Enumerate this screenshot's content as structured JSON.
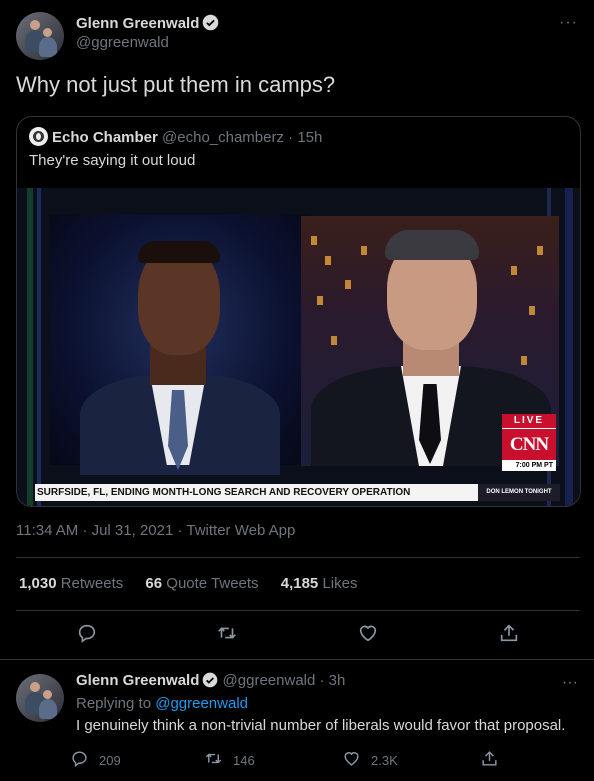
{
  "main_tweet": {
    "author_name": "Glenn Greenwald",
    "handle": "@ggreenwald",
    "text": "Why not just put them in camps?",
    "meta": "11:34 AM · Jul 31, 2021 · Twitter Web App",
    "more_icon": "more-icon"
  },
  "quote": {
    "author_name": "Echo Chamber",
    "handle": "@echo_chamberz",
    "time": "· 15h",
    "text": "They're saying it out loud"
  },
  "video": {
    "live_label": "LIVE",
    "network_logo": "CNN",
    "clock": "7:00 PM PT",
    "chyron": "SURFSIDE, FL, ENDING MONTH-LONG SEARCH AND RECOVERY OPERATION",
    "show_name": "DON LEMON TONIGHT"
  },
  "stats": {
    "retweets_count": "1,030",
    "retweets_label": "Retweets",
    "quotes_count": "66",
    "quotes_label": "Quote Tweets",
    "likes_count": "4,185",
    "likes_label": "Likes"
  },
  "actions": [
    "reply-icon",
    "retweet-icon",
    "like-icon",
    "share-icon"
  ],
  "reply_tweet": {
    "author_name": "Glenn Greenwald",
    "handle": "@ggreenwald",
    "time": "· 3h",
    "replying_prefix": "Replying to",
    "replying_handle": "@ggreenwald",
    "text": "I genuinely think a non-trivial number of liberals would favor that proposal.",
    "reply_count": "209",
    "retweet_count": "146",
    "like_count": "2.3K"
  },
  "colors": {
    "background": "#000000",
    "text": "#d9d9d9",
    "muted": "#6e767d",
    "link": "#1d9bf0",
    "border": "#2f3336",
    "cnn_red": "#c8102e"
  }
}
